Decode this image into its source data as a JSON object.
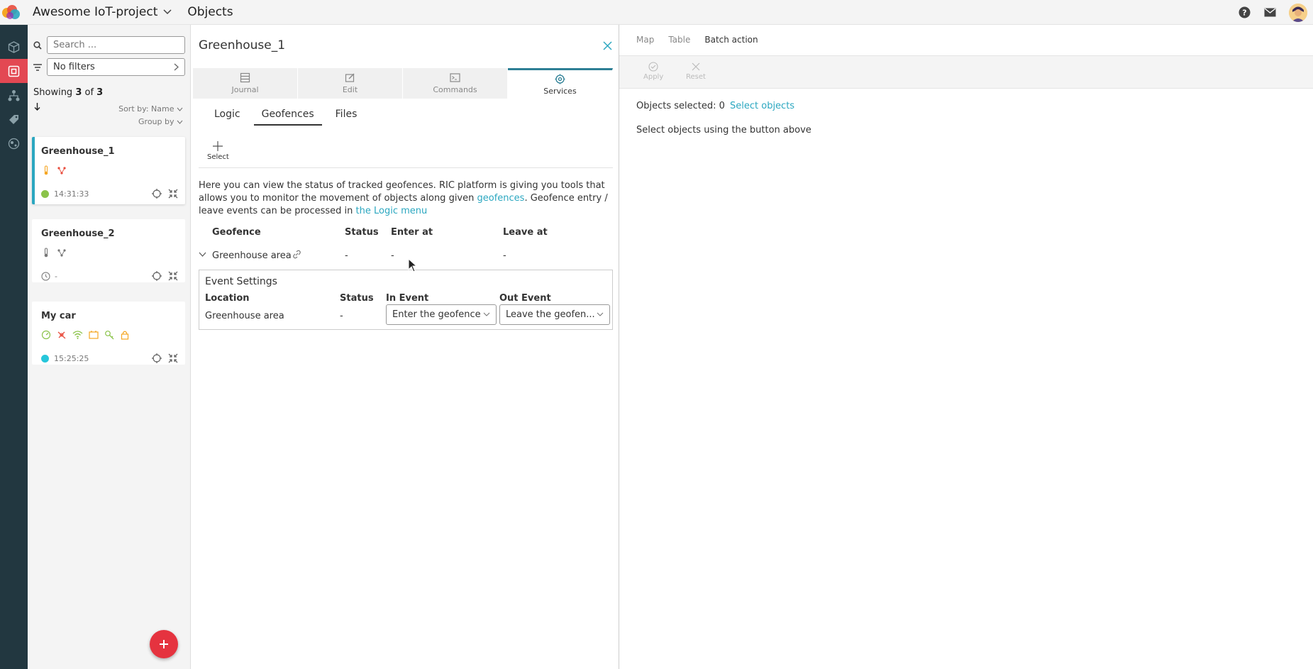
{
  "header": {
    "project_title": "Awesome IoT-project",
    "section_title": "Objects"
  },
  "sidebar": {
    "search_placeholder": "Search ...",
    "filter_label": "No filters",
    "showing_prefix": "Showing ",
    "showing_count": "3",
    "showing_of": " of ",
    "showing_total": "3",
    "sort_label": "Sort by: Name",
    "group_label": "Group by"
  },
  "objects": [
    {
      "name": "Greenhouse_1",
      "time": "14:31:33",
      "status_color": "#8bc34a"
    },
    {
      "name": "Greenhouse_2",
      "time": "-",
      "status_color": "#cccccc"
    },
    {
      "name": "My car",
      "time": "15:25:25",
      "status_color": "#26c6da"
    }
  ],
  "detail": {
    "title": "Greenhouse_1",
    "tabs": [
      {
        "label": "Journal"
      },
      {
        "label": "Edit"
      },
      {
        "label": "Commands"
      },
      {
        "label": "Services"
      }
    ],
    "subtabs": [
      {
        "label": "Logic"
      },
      {
        "label": "Geofences"
      },
      {
        "label": "Files"
      }
    ],
    "select_label": "Select",
    "description": {
      "part1": "Here you can view the status of tracked geofences. RIC platform is giving you tools that allows you to monitor the movement of objects along given ",
      "link1": "geofences",
      "part2": ". Geofence entry / leave events can be processed in ",
      "link2": "the Logic menu"
    },
    "geofence_table": {
      "headers": [
        "Geofence",
        "Status",
        "Enter at",
        "Leave at"
      ],
      "row": {
        "geofence": "Greenhouse area",
        "status": "-",
        "enter_at": "-",
        "leave_at": "-"
      }
    },
    "event_settings": {
      "title": "Event Settings",
      "headers": [
        "Location",
        "Status",
        "In Event",
        "Out Event"
      ],
      "row": {
        "location": "Greenhouse area",
        "status": "-",
        "in_event": "Enter the geofence",
        "out_event": "Leave the geofen..."
      }
    }
  },
  "right_panel": {
    "tabs": [
      {
        "label": "Map"
      },
      {
        "label": "Table"
      },
      {
        "label": "Batch action"
      }
    ],
    "apply_label": "Apply",
    "reset_label": "Reset",
    "objects_selected_label": "Objects selected: 0",
    "select_objects_label": "Select objects",
    "hint": "Select objects using the button above"
  },
  "colors": {
    "accent": "#2ba7c0",
    "rail": "#223740",
    "rail_active": "#e34853",
    "fab": "#e5333f"
  }
}
